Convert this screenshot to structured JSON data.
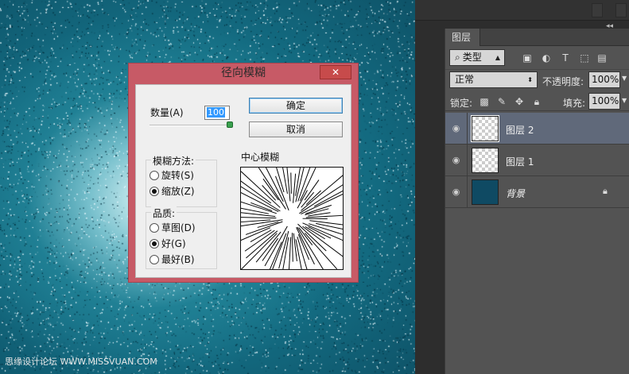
{
  "dialog": {
    "title": "径向模糊",
    "close_icon": "✕",
    "amount_label": "数量(A)",
    "amount_value": "100",
    "amount_slider_fraction": 1.0,
    "ok_label": "确定",
    "cancel_label": "取消",
    "method_group_label": "模糊方法:",
    "methods": [
      {
        "label": "旋转(S)",
        "selected": false
      },
      {
        "label": "缩放(Z)",
        "selected": true
      }
    ],
    "quality_group_label": "品质:",
    "qualities": [
      {
        "label": "草图(D)",
        "selected": false
      },
      {
        "label": "好(G)",
        "selected": true
      },
      {
        "label": "最好(B)",
        "selected": false
      }
    ],
    "center_label": "中心模糊"
  },
  "layers_panel": {
    "tab_label": "图层",
    "kind_label": "类型",
    "blend_mode": "正常",
    "opacity_label": "不透明度:",
    "opacity_value": "100%",
    "lock_label": "锁定:",
    "fill_label": "填充:",
    "fill_value": "100%",
    "layers": [
      {
        "name": "图层 2",
        "active": true,
        "thumb": "transparent"
      },
      {
        "name": "图层 1",
        "active": false,
        "thumb": "transparent"
      },
      {
        "name": "背景",
        "active": false,
        "thumb": "fill",
        "locked": true
      }
    ],
    "canvas_color": "#0f4a63"
  },
  "watermark": "思缘设计论坛 WWW.MISSVUAN.COM",
  "colors": {
    "dialog_frame": "#c75a66",
    "selection_highlight": "#3399ff",
    "active_layer": "#60697a"
  }
}
